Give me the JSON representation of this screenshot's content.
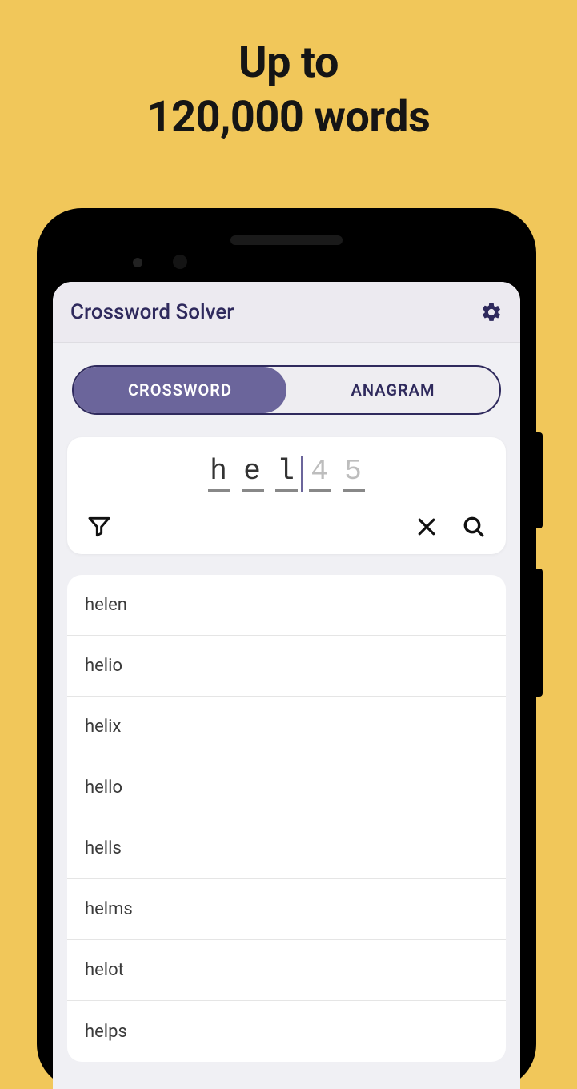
{
  "promo": {
    "line1": "Up to",
    "line2": "120,000 words"
  },
  "appBar": {
    "title": "Crossword Solver"
  },
  "tabs": {
    "crossword": "CROSSWORD",
    "anagram": "ANAGRAM",
    "active": "crossword"
  },
  "input": {
    "letters": [
      "h",
      "e",
      "l",
      "4",
      "5"
    ],
    "blanks": [
      false,
      false,
      false,
      true,
      true
    ]
  },
  "results": [
    "helen",
    "helio",
    "helix",
    "hello",
    "hells",
    "helms",
    "helot",
    "helps"
  ]
}
